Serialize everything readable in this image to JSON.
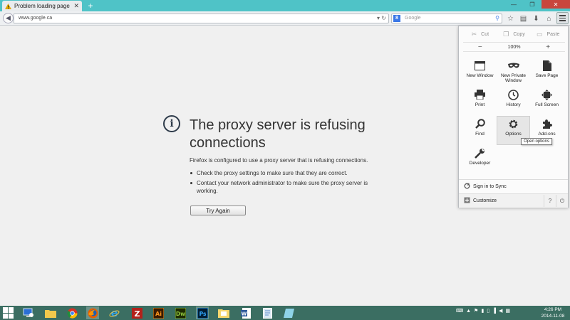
{
  "browser": {
    "tab_title": "Problem loading page",
    "url": "www.google.ca",
    "search_placeholder": "Google",
    "search_engine_letter": "8"
  },
  "error": {
    "title": "The proxy server is refusing connections",
    "description": "Firefox is configured to use a proxy server that is refusing connections.",
    "bullets": [
      "Check the proxy settings to make sure that they are correct.",
      "Contact your network administrator to make sure the proxy server is working."
    ],
    "try_again_label": "Try Again"
  },
  "menu_panel": {
    "edit": {
      "cut": "Cut",
      "copy": "Copy",
      "paste": "Paste"
    },
    "zoom": {
      "minus": "−",
      "level": "100%",
      "plus": "+"
    },
    "items": [
      {
        "label": "New Window",
        "icon": "window-icon"
      },
      {
        "label": "New Private Window",
        "icon": "mask-icon"
      },
      {
        "label": "Save Page",
        "icon": "page-icon"
      },
      {
        "label": "Print",
        "icon": "printer-icon"
      },
      {
        "label": "History",
        "icon": "clock-icon"
      },
      {
        "label": "Full Screen",
        "icon": "fullscreen-icon"
      },
      {
        "label": "Find",
        "icon": "magnifier-icon"
      },
      {
        "label": "Options",
        "icon": "gear-icon"
      },
      {
        "label": "Add-ons",
        "icon": "puzzle-icon"
      },
      {
        "label": "Developer",
        "icon": "wrench-icon"
      }
    ],
    "sign_in": "Sign in to Sync",
    "customize": "Customize",
    "tooltip": "Open options"
  },
  "taskbar": {
    "time": "4:26 PM",
    "date": "2014-11-08"
  },
  "colors": {
    "tabstrip": "#4fc3c7",
    "taskbar": "#3b6e62",
    "accent": "#3b78e7"
  }
}
